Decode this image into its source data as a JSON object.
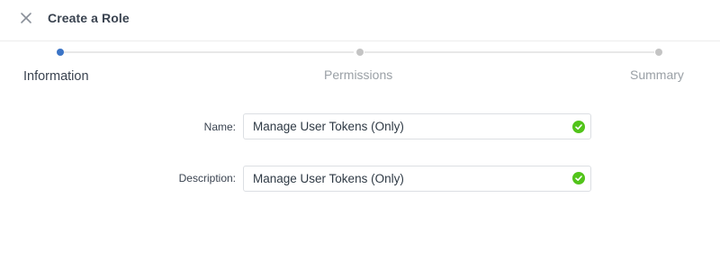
{
  "header": {
    "title": "Create a Role",
    "close_icon": "close-icon"
  },
  "stepper": {
    "steps": [
      {
        "label": "Information",
        "state": "active"
      },
      {
        "label": "Permissions",
        "state": "inactive"
      },
      {
        "label": "Summary",
        "state": "inactive"
      }
    ]
  },
  "form": {
    "name": {
      "label": "Name:",
      "value": "Manage User Tokens (Only)",
      "valid": true
    },
    "description": {
      "label": "Description:",
      "value": "Manage User Tokens (Only)",
      "valid": true
    }
  },
  "colors": {
    "accent": "#3b74c6",
    "success": "#52c41a",
    "inactive": "#c4c4c4"
  }
}
